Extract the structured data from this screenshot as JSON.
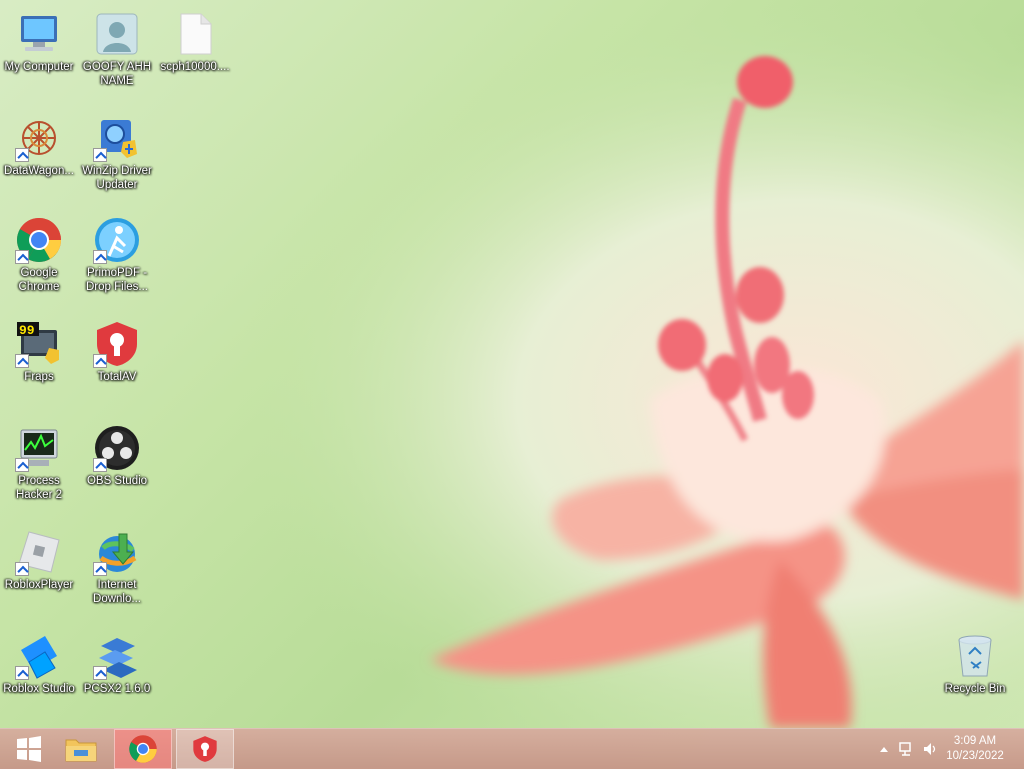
{
  "desktop": {
    "icons": [
      {
        "label": "My Computer",
        "icon": "computer-icon"
      },
      {
        "label": "GOOFY AHH NAME",
        "icon": "user-icon"
      },
      {
        "label": "scph10000....",
        "icon": "file-icon"
      },
      {
        "label": "DataWagon...",
        "icon": "datawagon-icon"
      },
      {
        "label": "WinZip Driver Updater",
        "icon": "winzip-icon"
      },
      {
        "label": "Google Chrome",
        "icon": "chrome-icon"
      },
      {
        "label": "PrimoPDF - Drop Files...",
        "icon": "primopdf-icon"
      },
      {
        "label": "Fraps",
        "icon": "fraps-icon"
      },
      {
        "label": "TotalAV",
        "icon": "totalav-icon"
      },
      {
        "label": "Process Hacker 2",
        "icon": "process-hacker-icon"
      },
      {
        "label": "OBS Studio",
        "icon": "obs-icon"
      },
      {
        "label": "RobloxPlayer",
        "icon": "roblox-icon"
      },
      {
        "label": "Internet Downlo...",
        "icon": "idm-icon"
      },
      {
        "label": "Roblox Studio",
        "icon": "roblox-studio-icon"
      },
      {
        "label": "PCSX2 1.6.0",
        "icon": "pcsx2-icon"
      },
      {
        "label": "Recycle Bin",
        "icon": "recycle-bin-icon"
      }
    ]
  },
  "taskbar": {
    "start": "windows-logo-icon",
    "pinned": [
      "file-explorer-icon",
      "chrome-icon",
      "totalav-icon"
    ],
    "clock": {
      "time": "3:09 AM",
      "date": "10/23/2022"
    }
  },
  "colors": {
    "taskbar": "#cfa294",
    "chrome_active": "#ff7878"
  }
}
